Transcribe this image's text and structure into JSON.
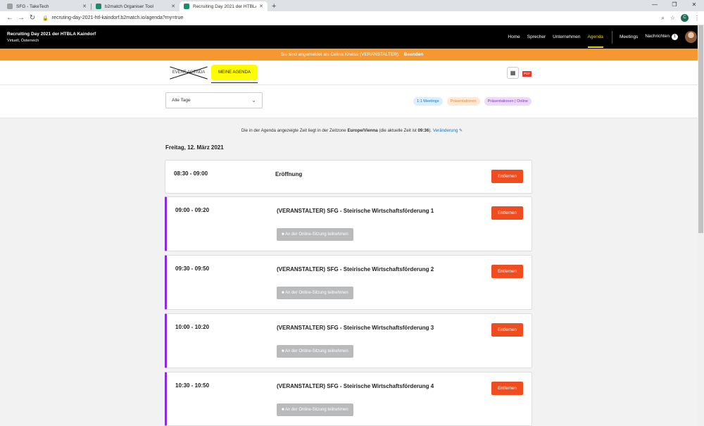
{
  "browser": {
    "tabs": [
      {
        "label": "SFG - TakeTech",
        "color": "#9e9e9e"
      },
      {
        "label": "b2match Organiser Tool",
        "color": "#1e8c6a"
      },
      {
        "label": "Recruiting Day 2021 der HTBLA Ka",
        "color": "#1e8c6a"
      }
    ],
    "url": "recruting-day-2021-htl-kaindorf.b2match.io/agenda?my=true",
    "profile_initial": "C"
  },
  "site": {
    "event_title": "Recruiting Day 2021 der HTBLA Kaindorf",
    "event_subtitle": "Virtuell, Österreich",
    "nav": {
      "home": "Home",
      "sprecher": "Sprecher",
      "unternehmen": "Unternehmen",
      "agenda": "Agenda",
      "meetings": "Meetings",
      "nachrichten": "Nachrichten",
      "nachrichten_count": "1"
    }
  },
  "banner": {
    "text": "Sie sind angemeldet als Celina Kneiss (VERANSTALTER).",
    "action": "Beenden"
  },
  "agenda_tabs": {
    "event": "EVENT AGENDA",
    "mine": "MEINE AGENDA",
    "pdf_label": "PDF"
  },
  "filters": {
    "day_select": "Alle Tage",
    "pills": [
      "1:1 Meetings",
      "Präsentationen",
      "Präsentationen | Online"
    ]
  },
  "timezone": {
    "prefix": "Die in der Agenda angezeigte Zeit liegt in der Zeitzone",
    "zone": "Europe/Vienna",
    "middle": "(die aktuelle Zeit ist",
    "time": "09:36",
    "suffix": ").",
    "change": "Veränderung"
  },
  "date_heading": "Freitag, 12. März 2021",
  "sessions": [
    {
      "time": "08:30 - 09:00",
      "title": "Eröffnung",
      "online": false
    },
    {
      "time": "09:00 - 09:20",
      "title": "(VERANSTALTER) SFG - Steirische Wirtschaftsförderung 1",
      "online": true
    },
    {
      "time": "09:30 - 09:50",
      "title": "(VERANSTALTER) SFG - Steirische Wirtschaftsförderung 2",
      "online": true
    },
    {
      "time": "10:00 - 10:20",
      "title": "(VERANSTALTER) SFG - Steirische Wirtschaftsförderung 3",
      "online": true
    },
    {
      "time": "10:30 - 10:50",
      "title": "(VERANSTALTER) SFG - Steirische Wirtschaftsförderung 4",
      "online": true
    }
  ],
  "labels": {
    "remove": "Entfernen",
    "join": "An der Online-Sitzung teilnehmen"
  }
}
